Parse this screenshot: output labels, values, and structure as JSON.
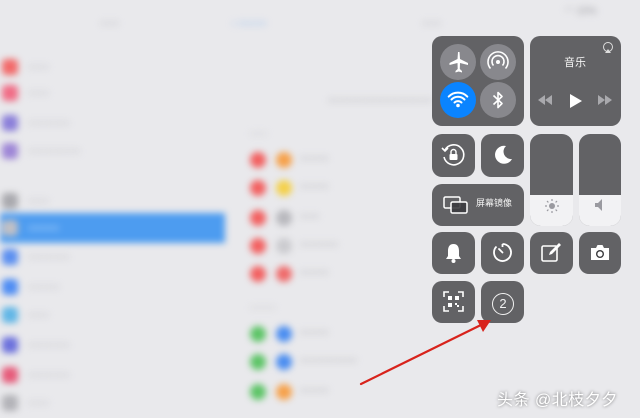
{
  "status_bar": {
    "battery": "15%"
  },
  "control_center": {
    "music": {
      "title": "音乐"
    },
    "screen_mirroring": {
      "label": "屏幕镜像"
    },
    "recording_badge": "2"
  },
  "watermark": "头条 @北枝夕夕",
  "colors": {
    "accent_blue": "#0a84ff",
    "arrow_red": "#d8231c"
  }
}
